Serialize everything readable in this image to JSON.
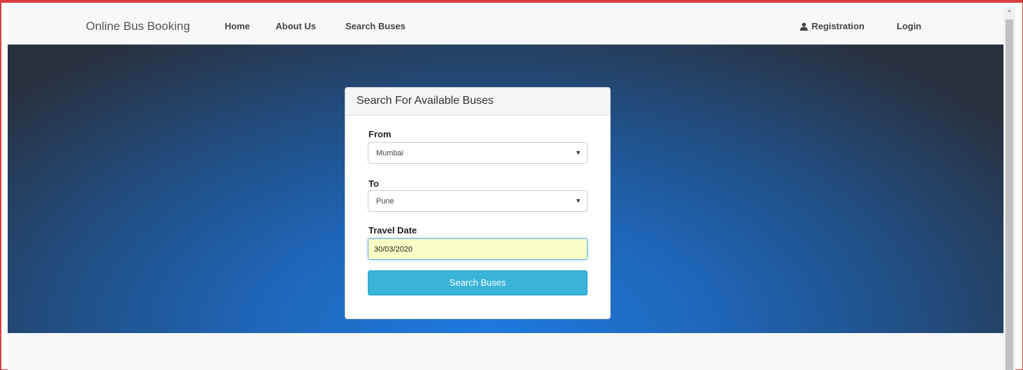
{
  "navbar": {
    "brand": "Online Bus Booking",
    "links": {
      "home": "Home",
      "about": "About Us",
      "search": "Search Buses"
    },
    "registration": "Registration",
    "login": "Login",
    "registration_icon": "user-icon"
  },
  "search_panel": {
    "heading": "Search For Available Buses",
    "from": {
      "label": "From",
      "value": "Mumbai"
    },
    "to": {
      "label": "To",
      "value": "Pune"
    },
    "travel_date": {
      "label": "Travel Date",
      "value": "30/03/2020"
    },
    "submit_label": "Search Buses"
  },
  "colors": {
    "accent_button": "#39b3d7",
    "hero_center": "#1e7ae0",
    "hero_edge": "#283140",
    "date_highlight": "#fafdc5",
    "frame_border": "#d94040"
  }
}
